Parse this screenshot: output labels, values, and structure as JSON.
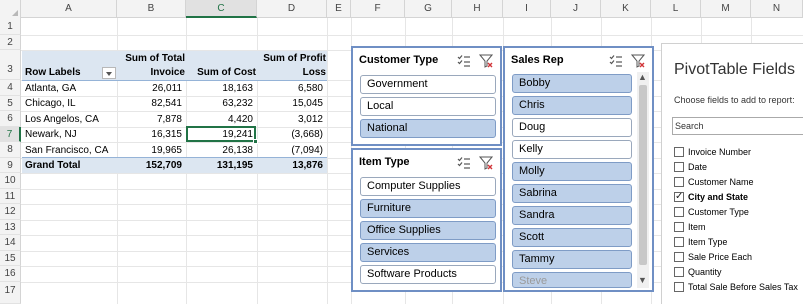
{
  "columns": [
    "A",
    "B",
    "C",
    "D",
    "E",
    "F",
    "G",
    "H",
    "I",
    "J",
    "K",
    "L",
    "M",
    "N"
  ],
  "selected_column": "C",
  "rows": [
    "1",
    "2",
    "3",
    "4",
    "5",
    "6",
    "7",
    "8",
    "9",
    "10",
    "11",
    "12",
    "13",
    "14",
    "15",
    "16",
    "17"
  ],
  "selected_row": "7",
  "pivot": {
    "header_b1": "Sum of Total",
    "header_d1": "Sum of Profit",
    "row_labels": "Row Labels",
    "header_b2": "Invoice",
    "header_c2": "Sum of Cost",
    "header_d2": "Loss",
    "rows": [
      {
        "label": "Atlanta, GA",
        "invoice": "26,011",
        "cost": "18,163",
        "profit": "6,580"
      },
      {
        "label": "Chicago, IL",
        "invoice": "82,541",
        "cost": "63,232",
        "profit": "15,045"
      },
      {
        "label": "Los Angelos, CA",
        "invoice": "7,878",
        "cost": "4,420",
        "profit": "3,012"
      },
      {
        "label": "Newark, NJ",
        "invoice": "16,315",
        "cost": "19,241",
        "profit": "(3,668)"
      },
      {
        "label": "San Francisco, CA",
        "invoice": "19,965",
        "cost": "26,138",
        "profit": "(7,094)"
      }
    ],
    "total": {
      "label": "Grand Total",
      "invoice": "152,709",
      "cost": "131,195",
      "profit": "13,876"
    }
  },
  "slicers": {
    "customer_type": {
      "title": "Customer Type",
      "items": [
        {
          "label": "Government",
          "selected": false
        },
        {
          "label": "Local",
          "selected": false
        },
        {
          "label": "National",
          "selected": true
        }
      ]
    },
    "item_type": {
      "title": "Item Type",
      "items": [
        {
          "label": "Computer Supplies",
          "selected": false
        },
        {
          "label": "Furniture",
          "selected": true
        },
        {
          "label": "Office Supplies",
          "selected": true
        },
        {
          "label": "Services",
          "selected": true
        },
        {
          "label": "Software Products",
          "selected": false
        }
      ]
    },
    "sales_rep": {
      "title": "Sales Rep",
      "items": [
        {
          "label": "Bobby",
          "selected": true
        },
        {
          "label": "Chris",
          "selected": true
        },
        {
          "label": "Doug",
          "selected": false
        },
        {
          "label": "Kelly",
          "selected": false
        },
        {
          "label": "Molly",
          "selected": true
        },
        {
          "label": "Sabrina",
          "selected": true
        },
        {
          "label": "Sandra",
          "selected": true
        },
        {
          "label": "Scott",
          "selected": true
        },
        {
          "label": "Tammy",
          "selected": true
        },
        {
          "label": "Steve",
          "selected": true
        }
      ]
    }
  },
  "pivot_fields": {
    "title": "PivotTable Fields",
    "subtitle": "Choose fields to add to report:",
    "search_placeholder": "Search",
    "fields": [
      {
        "label": "Invoice Number",
        "checked": false
      },
      {
        "label": "Date",
        "checked": false
      },
      {
        "label": "Customer Name",
        "checked": false
      },
      {
        "label": "City and State",
        "checked": true
      },
      {
        "label": "Customer Type",
        "checked": false
      },
      {
        "label": "Item",
        "checked": false
      },
      {
        "label": "Item Type",
        "checked": false
      },
      {
        "label": "Sale Price Each",
        "checked": false
      },
      {
        "label": "Quantity",
        "checked": false
      },
      {
        "label": "Total Sale Before Sales Tax",
        "checked": false
      }
    ]
  },
  "colors": {
    "accent_green": "#217346",
    "slicer_border": "#6f8fc4",
    "slicer_selected": "#bdd0e9",
    "pivot_header": "#dce6f1"
  },
  "icons": [
    "multi-select-icon",
    "clear-filter-icon",
    "scroll-up-icon",
    "scroll-down-icon",
    "dropdown-arrow-icon"
  ]
}
